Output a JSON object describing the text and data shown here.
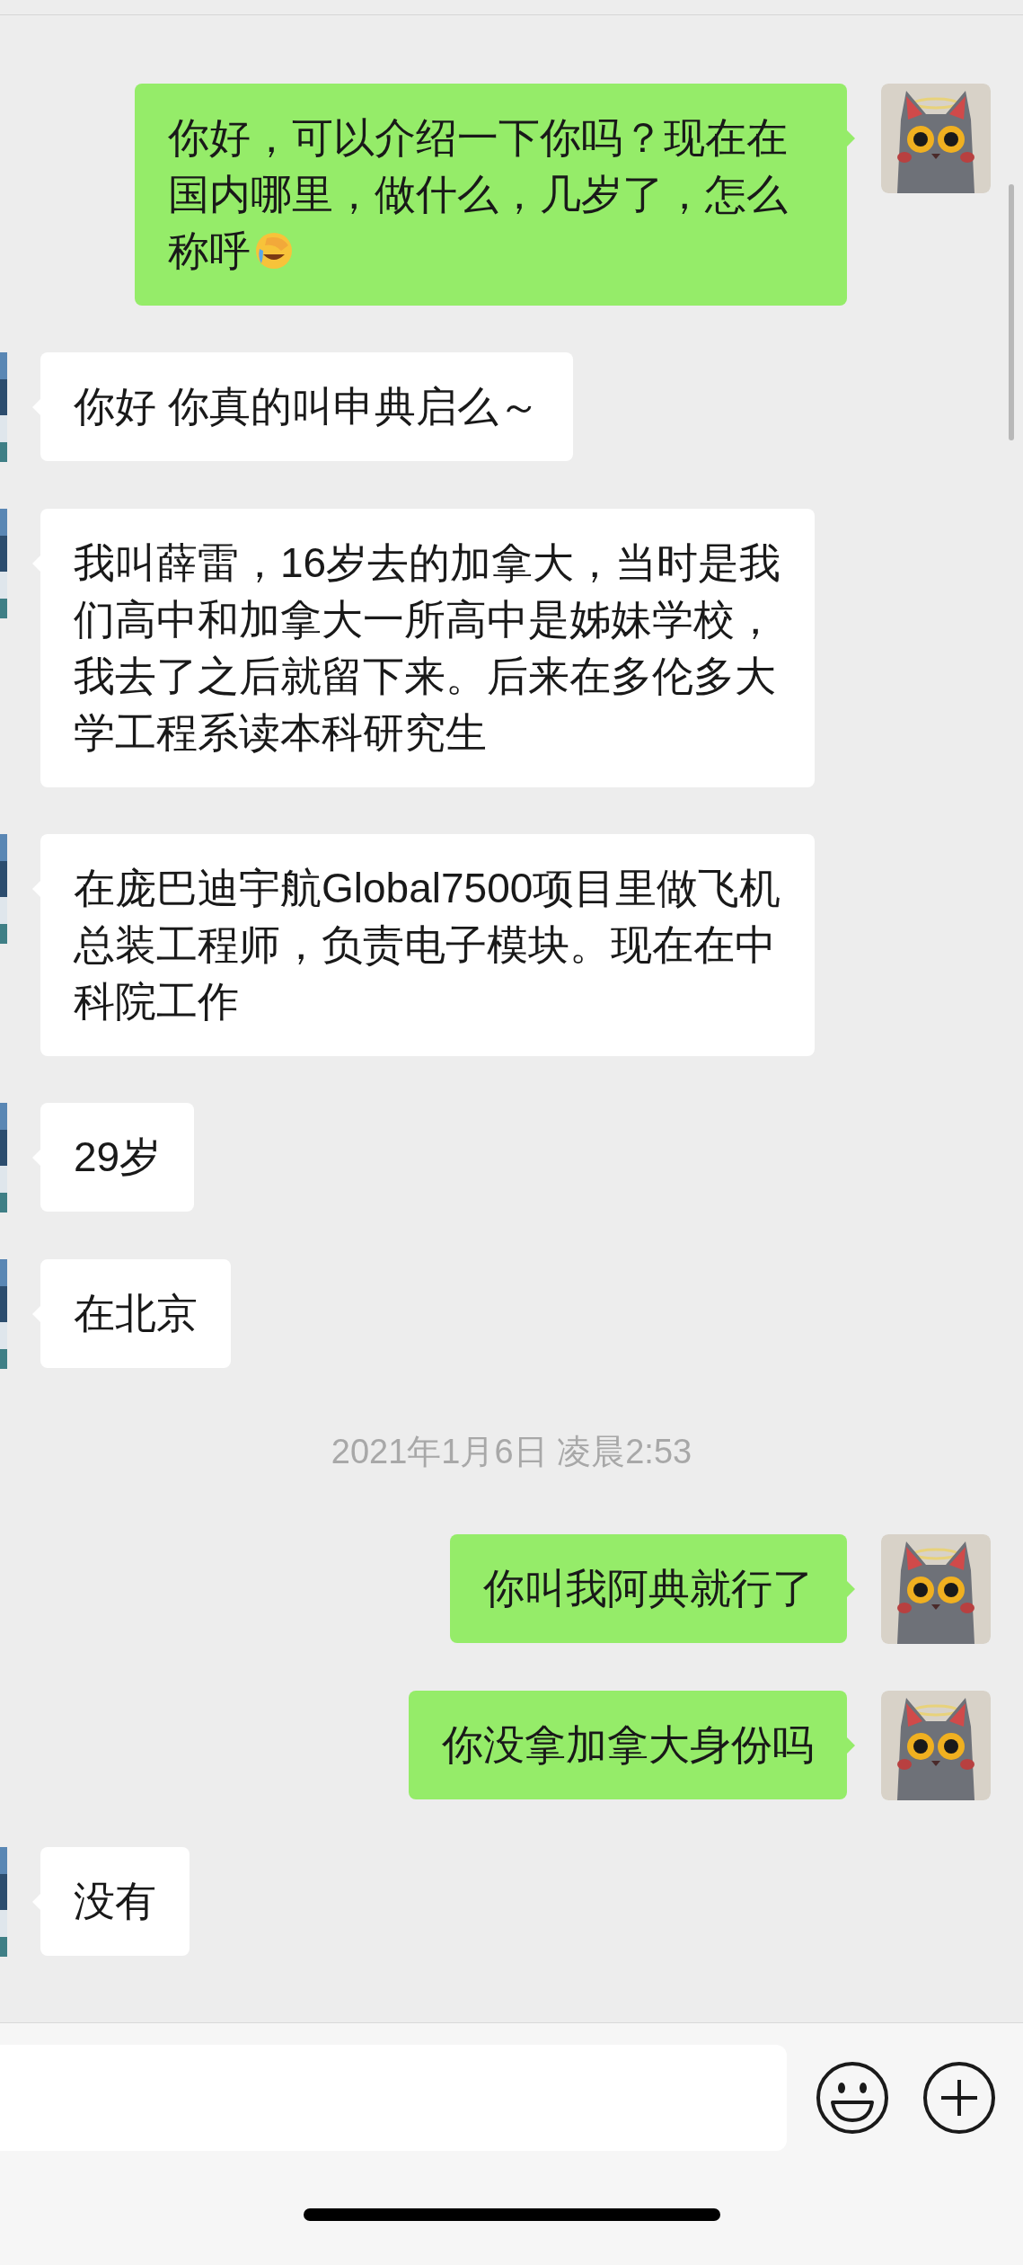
{
  "messages": [
    {
      "kind": "sent",
      "text": "你好，可以介绍一下你吗？现在在国内哪里，做什么，几岁了，怎么称呼",
      "emoji": true
    },
    {
      "kind": "received",
      "text": "你好 你真的叫申典启么～"
    },
    {
      "kind": "received",
      "text": "我叫薛雷，16岁去的加拿大，当时是我们高中和加拿大一所高中是姊妹学校，我去了之后就留下来。后来在多伦多大学工程系读本科研究生"
    },
    {
      "kind": "received",
      "text": "在庞巴迪宇航Global7500项目里做飞机总装工程师，负责电子模块。现在在中科院工作"
    },
    {
      "kind": "received",
      "text": "29岁"
    },
    {
      "kind": "received",
      "text": "在北京"
    },
    {
      "kind": "time",
      "text": "2021年1月6日 凌晨2:53"
    },
    {
      "kind": "sent",
      "text": "你叫我阿典就行了"
    },
    {
      "kind": "sent",
      "text": "你没拿加拿大身份吗"
    },
    {
      "kind": "received",
      "text": "没有"
    }
  ]
}
